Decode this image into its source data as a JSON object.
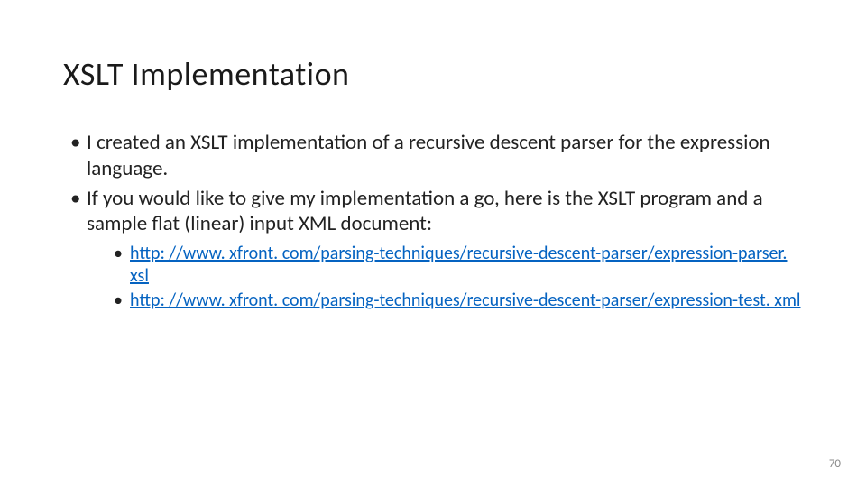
{
  "title": "XSLT Implementation",
  "bullets": {
    "b1": "I created an XSLT implementation of a recursive descent parser for the expression language.",
    "b2": "If you would like to give my implementation a go, here is the XSLT program and a sample flat (linear) input XML document:"
  },
  "links": {
    "l1": "http: //www. xfront. com/parsing-techniques/recursive-descent-parser/expression-parser. xsl",
    "l2": "http: //www. xfront. com/parsing-techniques/recursive-descent-parser/expression-test. xml"
  },
  "page_number": "70"
}
